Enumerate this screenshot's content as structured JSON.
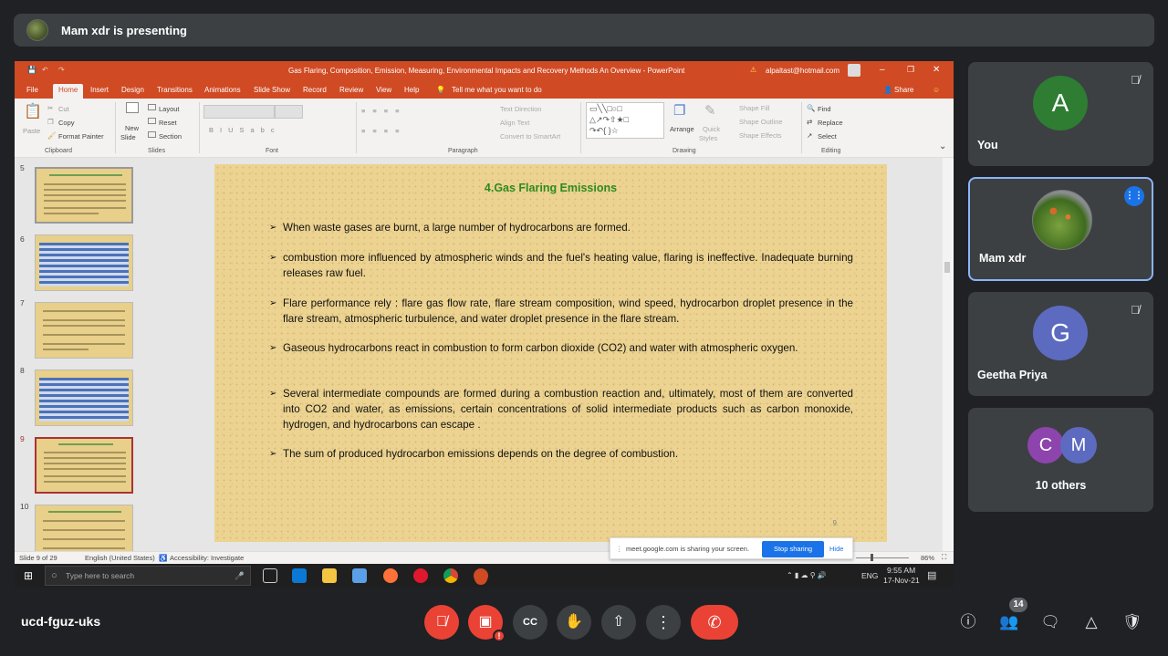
{
  "meet": {
    "presenting_text": "Mam xdr is presenting",
    "meeting_code": "ucd-fguz-uks",
    "people_count": "14",
    "participants": [
      {
        "name": "You",
        "initial": "A",
        "color": "#2e7d32",
        "muted": true
      },
      {
        "name": "Mam xdr",
        "initial": "",
        "color": "#556b2f",
        "speaking": true
      },
      {
        "name": "Geetha Priya",
        "initial": "G",
        "color": "#5c6bc0",
        "muted": true
      },
      {
        "name": "10 others",
        "initials": [
          "C",
          "M"
        ],
        "colors": [
          "#8e44ad",
          "#5c6bc0"
        ]
      }
    ]
  },
  "powerpoint": {
    "window_title": "Gas Flaring, Composition, Emission, Measuring, Environmental Impacts and Recovery Methods An Overview - PowerPoint",
    "account": "alpaltast@hotmail.com",
    "tabs": [
      "File",
      "Home",
      "Insert",
      "Design",
      "Transitions",
      "Animations",
      "Slide Show",
      "Record",
      "Review",
      "View",
      "Help"
    ],
    "tell_me": "Tell me what you want to do",
    "share": "Share",
    "ribbon": {
      "paste": "Paste",
      "cut": "Cut",
      "copy": "Copy",
      "format_painter": "Format Painter",
      "clipboard": "Clipboard",
      "new_slide": "New",
      "new_slide2": "Slide",
      "layout": "Layout",
      "reset": "Reset",
      "section": "Section",
      "slides": "Slides",
      "font": "Font",
      "text_direction": "Text Direction",
      "align_text": "Align Text",
      "convert_smartart": "Convert to SmartArt",
      "paragraph": "Paragraph",
      "arrange": "Arrange",
      "quick_styles": "Quick",
      "quick_styles2": "Styles",
      "shape_fill": "Shape Fill",
      "shape_outline": "Shape Outline",
      "shape_effects": "Shape Effects",
      "drawing": "Drawing",
      "find": "Find",
      "replace": "Replace",
      "select": "Select",
      "editing": "Editing"
    },
    "thumb_numbers": [
      "5",
      "6",
      "7",
      "8",
      "9",
      "10"
    ],
    "slide": {
      "title": "4.Gas Flaring Emissions",
      "bullets": [
        "When waste gases are burnt, a large number of hydrocarbons are formed.",
        "combustion  more influenced by atmospheric winds and the fuel's heating value, flaring is ineffective. Inadequate burning releases raw fuel.",
        "Flare performance  rely : flare gas flow rate, flare stream composition, wind speed, hydrocarbon droplet presence in the flare stream, atmospheric turbulence, and water droplet presence in the flare stream.",
        "Gaseous hydrocarbons react in combustion to form carbon dioxide (CO2) and water with atmospheric oxygen.",
        "Several intermediate compounds are formed during a combustion reaction and, ultimately, most of them are converted into CO2 and water, as emissions, certain concentrations of solid intermediate products such as carbon monoxide, hydrogen, and hydrocarbons can escape .",
        "The sum of produced hydrocarbon emissions depends on the degree of combustion."
      ],
      "number": "9"
    },
    "status": {
      "slide_of": "Slide 9 of 29",
      "language": "English (United States)",
      "accessibility": "Accessibility: Investigate",
      "zoom": "86%"
    },
    "sharing_notice": "meet.google.com is sharing your screen.",
    "stop_sharing": "Stop sharing",
    "hide": "Hide"
  },
  "taskbar": {
    "search_placeholder": "Type here to search",
    "lang": "ENG",
    "time": "9:55 AM",
    "date": "17-Nov-21"
  }
}
